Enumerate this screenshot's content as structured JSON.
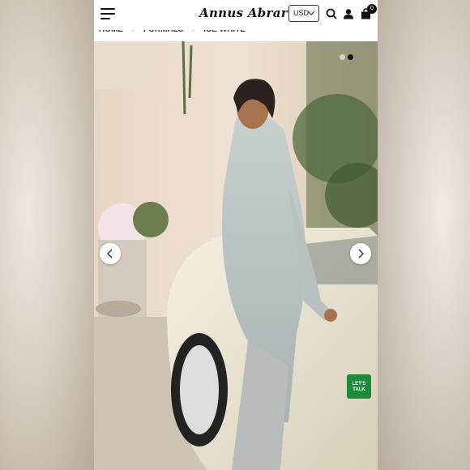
{
  "header": {
    "logo": "Annus Abrar",
    "currency": "USD",
    "cart_count": "0"
  },
  "breadcrumb": {
    "items": [
      "HOME",
      "FORMALS",
      "ICE WHITE"
    ]
  },
  "gallery": {
    "slide_count": 2,
    "active_slide": 2
  },
  "chat": {
    "label": "LET'S TALK"
  },
  "colors": {
    "header_bg": "#ffffff",
    "icon": "#111111",
    "chat_button": "#1d8a3a"
  }
}
